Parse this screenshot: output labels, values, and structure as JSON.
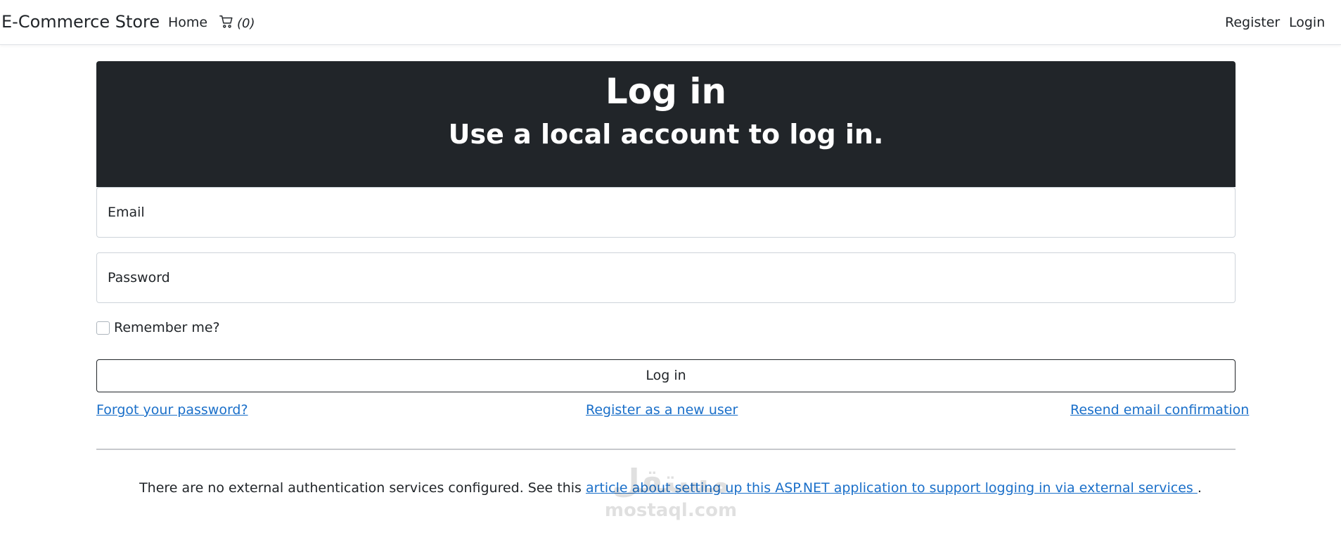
{
  "navbar": {
    "brand": "E-Commerce Store",
    "home": "Home",
    "cart_count": "(0)",
    "register": "Register",
    "login": "Login"
  },
  "header": {
    "title": "Log in",
    "subtitle": "Use a local account to log in."
  },
  "form": {
    "email_label": "Email",
    "email_value": "",
    "password_label": "Password",
    "password_value": "",
    "remember_label": "Remember me?",
    "remember_checked": false,
    "submit_label": "Log in"
  },
  "links": {
    "forgot": "Forgot your password?",
    "register_new": "Register as a new user",
    "resend": "Resend email confirmation"
  },
  "external": {
    "text": "There are no external authentication services configured. See this ",
    "link_text": "article about setting up this ASP.NET application to support logging in via external services ",
    "suffix": "."
  },
  "watermark": {
    "arabic": "مستقل",
    "latin": "mostaql.com"
  },
  "colors": {
    "header_bg": "#212529",
    "link": "#1a6fc9"
  },
  "icons": {
    "cart": "cart-icon"
  }
}
